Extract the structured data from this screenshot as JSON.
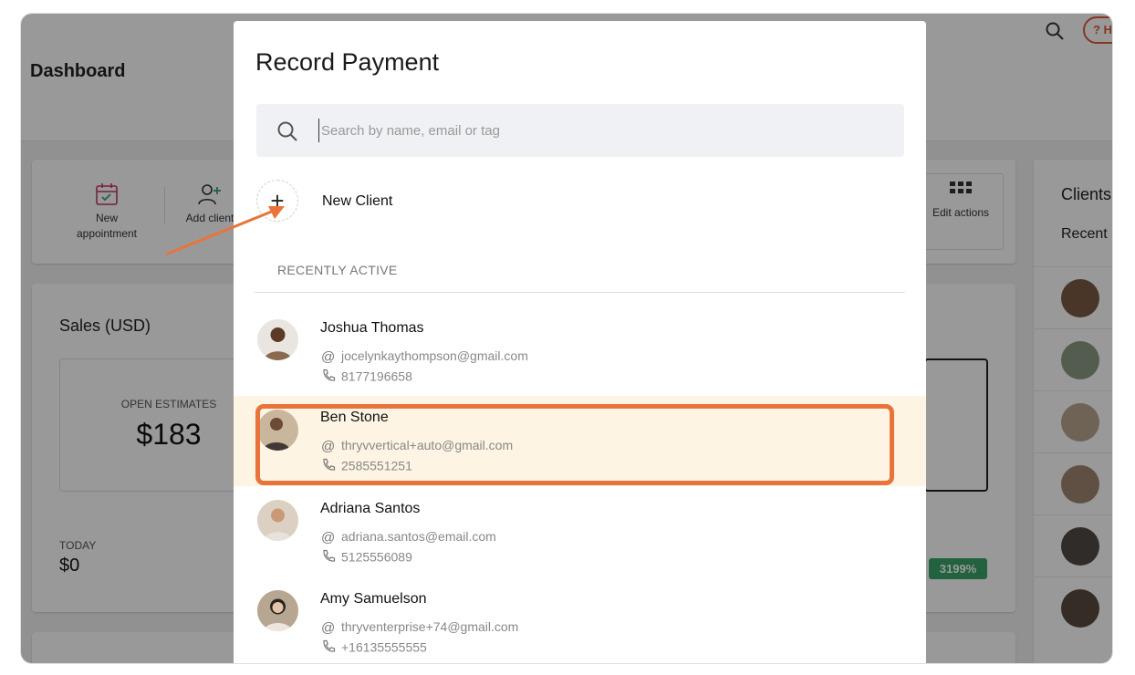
{
  "background": {
    "dashboard_title": "Dashboard",
    "help_label": "? H",
    "quick_actions": [
      {
        "label": "New appointment",
        "icon": "calendar-icon"
      },
      {
        "label": "Add client",
        "icon": "add-user-icon"
      },
      {
        "label": "Edit actions",
        "icon": "grid-icon"
      }
    ],
    "sales": {
      "title": "Sales (USD)",
      "open_estimates_label": "OPEN ESTIMATES",
      "open_estimates_value": "$183",
      "today_label": "TODAY",
      "today_value": "$0",
      "badge": "3199%"
    },
    "clients_panel": {
      "title": "Clients",
      "recent_label": "Recent"
    }
  },
  "modal": {
    "title": "Record Payment",
    "search": {
      "placeholder": "Search by name, email or tag",
      "value": ""
    },
    "new_client_label": "New Client",
    "section_label": "RECENTLY ACTIVE",
    "clients": [
      {
        "name": "Joshua Thomas",
        "email": "jocelynkaythompson@gmail.com",
        "phone": "8177196658",
        "highlighted": false
      },
      {
        "name": "Ben Stone",
        "email": "thryvvertical+auto@gmail.com",
        "phone": "2585551251",
        "highlighted": true
      },
      {
        "name": "Adriana Santos",
        "email": "adriana.santos@email.com",
        "phone": "5125556089",
        "highlighted": false
      },
      {
        "name": "Amy Samuelson",
        "email": "thryventerprise+74@gmail.com",
        "phone": "+16135555555",
        "highlighted": false
      }
    ]
  },
  "colors": {
    "accent": "#e8743b",
    "highlight_bg": "#fdf4e3",
    "badge_green": "#3aa36a"
  },
  "icons": {
    "email": "@",
    "phone": "phone-icon",
    "add": "+"
  }
}
